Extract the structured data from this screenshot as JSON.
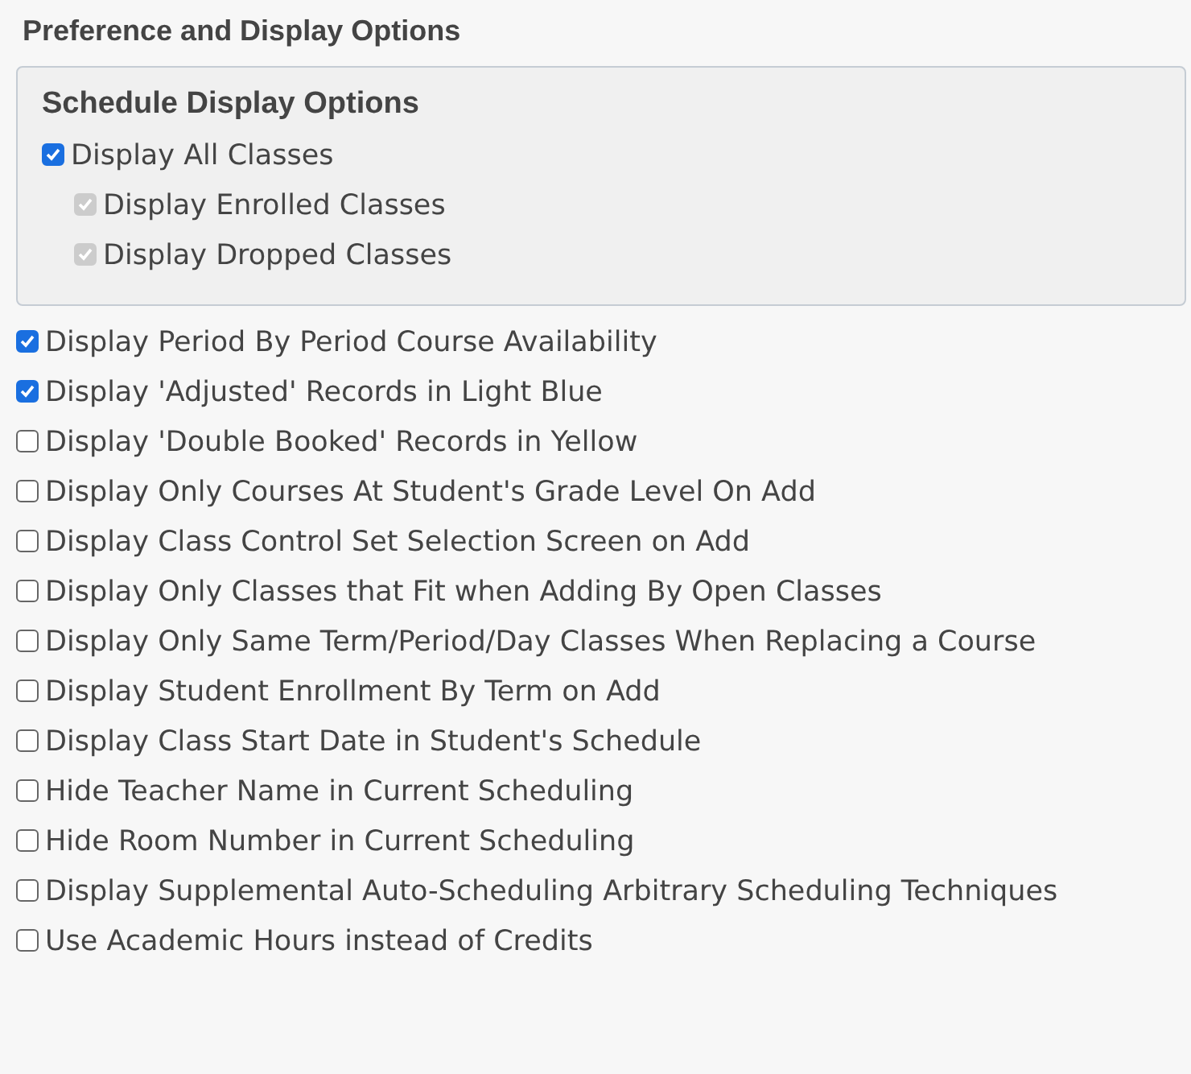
{
  "title": "Preference and Display Options",
  "schedule_panel": {
    "title": "Schedule Display Options",
    "options": [
      {
        "label": "Display All Classes",
        "checked": true,
        "disabled": false,
        "children": [
          {
            "label": "Display Enrolled Classes",
            "checked": true,
            "disabled": true
          },
          {
            "label": "Display Dropped Classes",
            "checked": true,
            "disabled": true
          }
        ]
      }
    ]
  },
  "options": [
    {
      "label": "Display Period By Period Course Availability",
      "checked": true
    },
    {
      "label": "Display 'Adjusted' Records in Light Blue",
      "checked": true
    },
    {
      "label": "Display 'Double Booked' Records in Yellow",
      "checked": false
    },
    {
      "label": "Display Only Courses At Student's Grade Level On Add",
      "checked": false
    },
    {
      "label": "Display Class Control Set Selection Screen on Add",
      "checked": false
    },
    {
      "label": "Display Only Classes that Fit when Adding By Open Classes",
      "checked": false
    },
    {
      "label": "Display Only Same Term/Period/Day Classes When Replacing a Course",
      "checked": false
    },
    {
      "label": "Display Student Enrollment By Term on Add",
      "checked": false
    },
    {
      "label": "Display Class Start Date in Student's Schedule",
      "checked": false
    },
    {
      "label": "Hide Teacher Name in Current Scheduling",
      "checked": false
    },
    {
      "label": "Hide Room Number in Current Scheduling",
      "checked": false
    },
    {
      "label": "Display Supplemental Auto-Scheduling Arbitrary Scheduling Techniques",
      "checked": false
    },
    {
      "label": "Use Academic Hours instead of Credits",
      "checked": false
    }
  ]
}
